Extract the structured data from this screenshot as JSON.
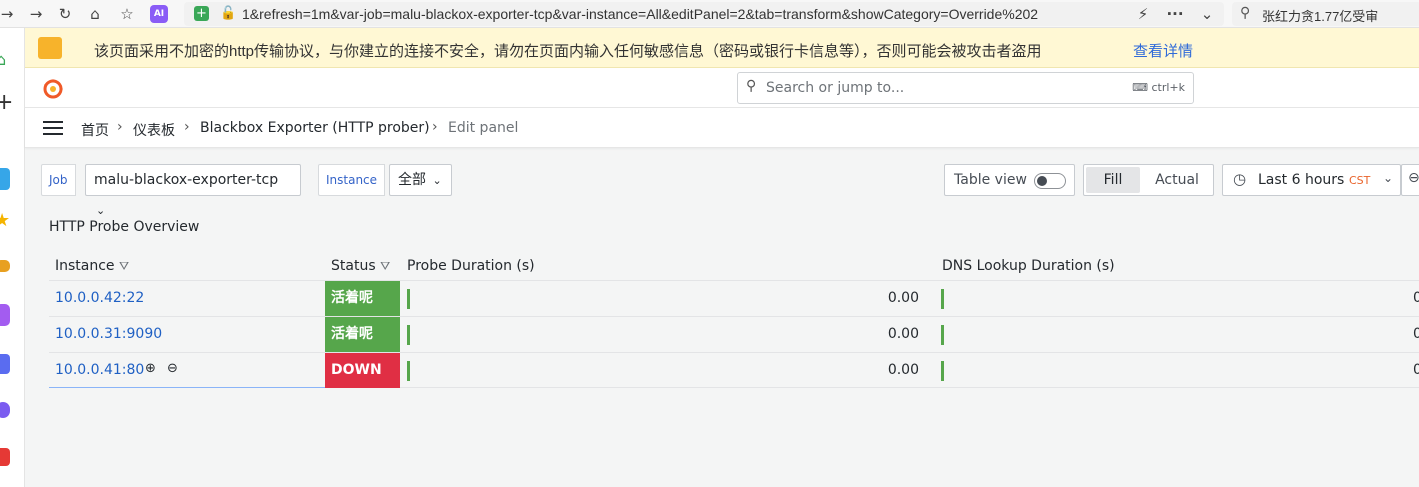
{
  "browser": {
    "url": "1&refresh=1m&var-job=malu-blackox-exporter-tcp&var-instance=All&editPanel=2&tab=transform&showCategory=Override%202",
    "search_text": "张红力贪1.77亿受审",
    "ai_badge": "AI"
  },
  "warning": {
    "text": "该页面采用不加密的http传输协议，与你建立的连接不安全，请勿在页面内输入任何敏感信息（密码或银行卡信息等），否则可能会被攻击者盗用",
    "link": "查看详情"
  },
  "search": {
    "placeholder": "Search or jump to...",
    "shortcut": "ctrl+k"
  },
  "breadcrumb": [
    "首页",
    "仪表板",
    "Blackbox Exporter (HTTP prober)",
    "Edit panel"
  ],
  "variables": {
    "job_label": "Job",
    "job_value": "malu-blackox-exporter-tcp",
    "instance_label": "Instance",
    "instance_value": "全部"
  },
  "toolbar": {
    "table_view": "Table view",
    "fill": "Fill",
    "actual": "Actual",
    "time_range": "Last 6 hours",
    "timezone": "CST"
  },
  "panel": {
    "title": "HTTP Probe Overview",
    "columns": [
      "Instance",
      "Status",
      "Probe Duration (s)",
      "DNS Lookup Duration (s)"
    ],
    "rows": [
      {
        "instance": "10.0.0.42:22",
        "status": "活着呢",
        "probe": "0.00",
        "dns": "0"
      },
      {
        "instance": "10.0.0.31:9090",
        "status": "活着呢",
        "probe": "0.00",
        "dns": "0"
      },
      {
        "instance": "10.0.0.41:80",
        "status": "DOWN",
        "probe": "0.00",
        "dns": "0"
      }
    ]
  },
  "colors": {
    "up": "#56a64b",
    "down": "#e02f44",
    "accent": "#1f60c4",
    "grafana_orange": "#f05a28"
  }
}
